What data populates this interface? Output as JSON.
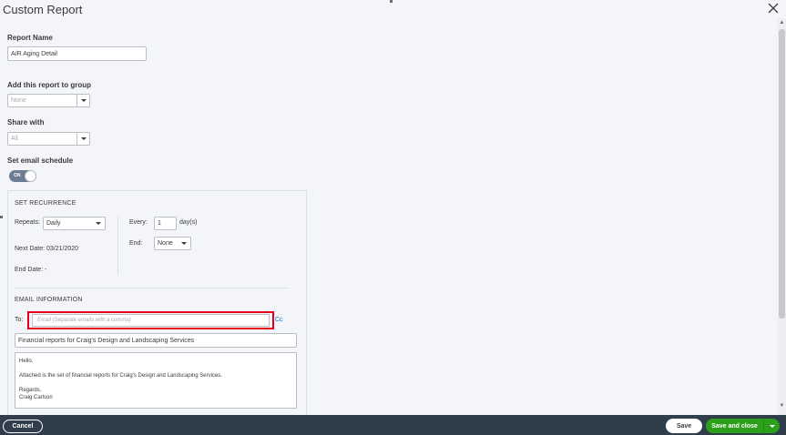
{
  "window": {
    "title": "Custom Report",
    "close_icon": "close-icon"
  },
  "report_name": {
    "label": "Report Name",
    "value": "A/R Aging Detail"
  },
  "group": {
    "label": "Add this report to group",
    "value": "None"
  },
  "share": {
    "label": "Share with",
    "value": "All"
  },
  "email_schedule": {
    "label": "Set email schedule",
    "toggle_text": "ON",
    "enabled": true
  },
  "recurrence": {
    "heading": "SET RECURRENCE",
    "repeats_label": "Repeats:",
    "repeats_value": "Daily",
    "every_label": "Every:",
    "every_value": "1",
    "every_unit": "day(s)",
    "end_label": "End:",
    "end_value": "None",
    "next_date": "Next Date: 03/21/2020",
    "end_date": "End Date: -"
  },
  "email": {
    "heading": "EMAIL INFORMATION",
    "to_label": "To:",
    "to_placeholder": "Email (Separate emails with a comma)",
    "cc_label": "Cc",
    "subject": "Financial reports for Craig's Design and Landscaping Services",
    "body": {
      "greeting": "Hello,",
      "line1": "Attached is the set of financial reports for Craig's Design and Landscaping Services.",
      "closing": "Regards,",
      "signature": "Craig Carlson"
    }
  },
  "footer": {
    "cancel": "Cancel",
    "save": "Save",
    "save_and_close": "Save and close"
  },
  "colors": {
    "footer_bg": "#303d4a",
    "primary_green": "#2ca01c",
    "highlight_red": "#e4001b",
    "link_blue": "#0077c5"
  }
}
